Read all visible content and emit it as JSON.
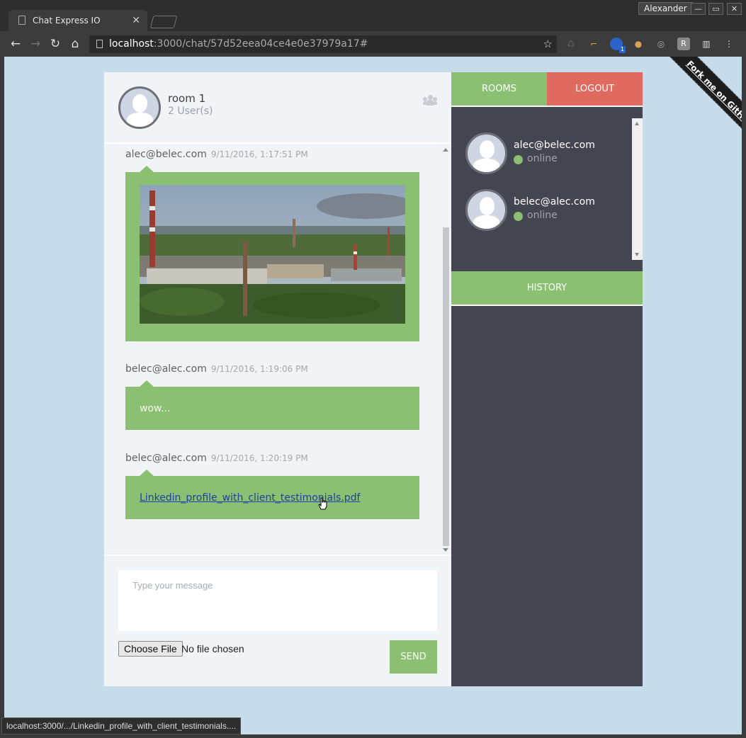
{
  "browser": {
    "tab_title": "Chat Express IO",
    "profile_name": "Alexander",
    "url_host": "localhost",
    "url_rest": ":3000/chat/57d52eea04ce4e0e37979a17#",
    "status_url": "localhost:3000/.../Linkedin_profile_with_client_testimonials....",
    "ext_badge": "1",
    "ext_r": "R"
  },
  "room": {
    "name": "room 1",
    "user_count": "2 User(s)"
  },
  "messages": [
    {
      "author": "alec@belec.com",
      "time": "9/11/2016, 1:17:51 PM",
      "kind": "image"
    },
    {
      "author": "belec@alec.com",
      "time": "9/11/2016, 1:19:06 PM",
      "kind": "text",
      "text": "wow..."
    },
    {
      "author": "belec@alec.com",
      "time": "9/11/2016, 1:20:19 PM",
      "kind": "file",
      "text": "Linkedin_profile_with_client_testimonials.pdf"
    }
  ],
  "composer": {
    "placeholder": "Type your message",
    "choose_file": "Choose File",
    "file_status": "No file chosen",
    "send": "SEND"
  },
  "sidebar": {
    "rooms": "ROOMS",
    "logout": "LOGOUT",
    "history": "HISTORY",
    "users": [
      {
        "email": "alec@belec.com",
        "status": "online"
      },
      {
        "email": "belec@alec.com",
        "status": "online"
      }
    ]
  },
  "ribbon": "Fork me on GitHub",
  "colors": {
    "accent_green": "#8bbf71",
    "logout_red": "#e06960",
    "sidebar_bg": "#434650",
    "page_bg": "#c6dcea"
  }
}
